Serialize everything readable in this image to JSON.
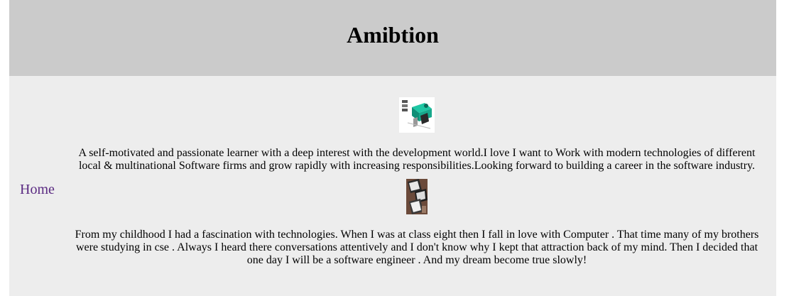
{
  "header": {
    "title": "Amibtion"
  },
  "nav": {
    "home_label": "Home"
  },
  "main": {
    "paragraph1": "A self-motivated and passionate learner with a deep interest with the development world.I love I want to Work with modern technologies of different local & multinational Software firms and grow rapidly with increasing responsibilities.Looking forward to building a career in the software industry.",
    "paragraph2": "From my childhood I had a fascination with technologies. When I was at class eight then I fall in love with Computer . That time many of my brothers were studying in cse . Always I heard there conversations attentively and I don't know why I kept that attraction back of my mind. Then I decided that one day I will be a software engineer . And my dream become true slowly!",
    "image1_icon": "developer-desk-illustration",
    "image2_icon": "devices-photo"
  },
  "colors": {
    "header_bg": "#cbcbcb",
    "body_bg": "#ededed",
    "link": "#5a2a82",
    "accent": "#1fc7a4"
  }
}
